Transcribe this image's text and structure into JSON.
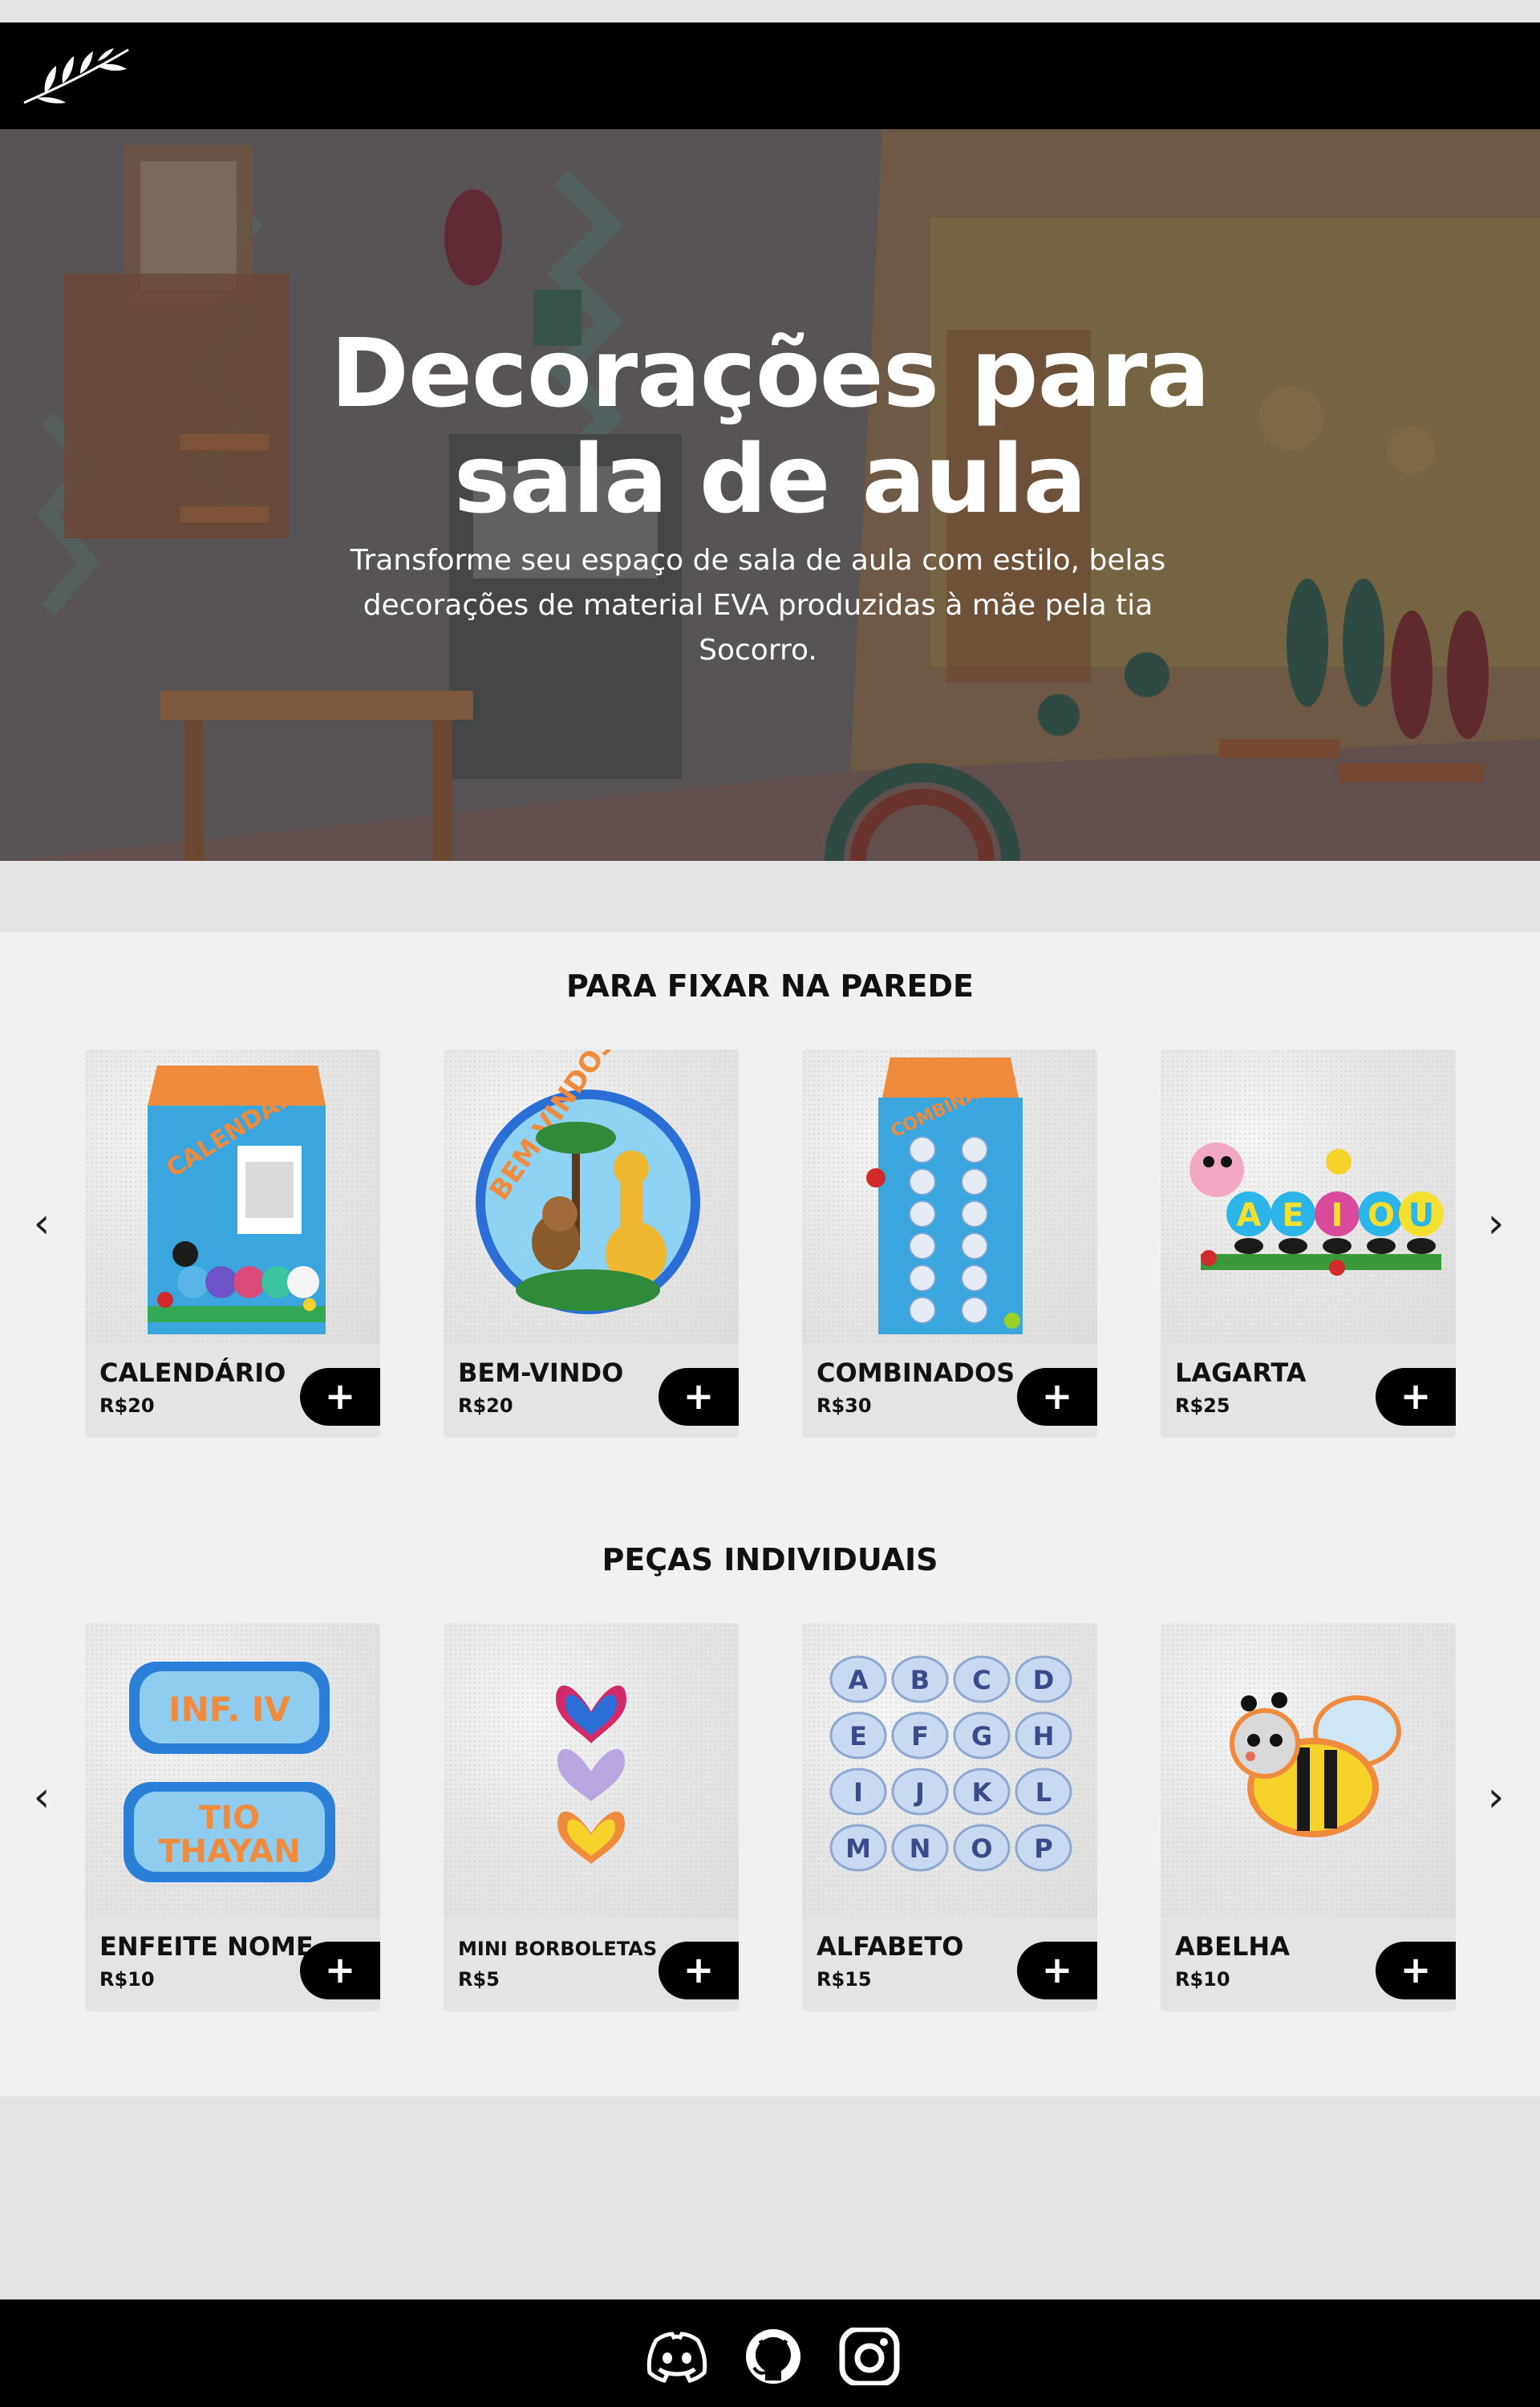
{
  "header": {
    "logo_icon": "leaf-branch-logo-icon"
  },
  "hero": {
    "title_line1": "Decorações para",
    "title_line2": "sala de aula",
    "subtitle": "Transforme seu espaço de sala de aula com estilo, belas decorações de material EVA produzidas à mãe pela tia Socorro."
  },
  "carousel_arrows": {
    "prev": "‹",
    "next": "›"
  },
  "section_wall": {
    "title": "PARA FIXAR NA PAREDE",
    "items": [
      {
        "name": "CALENDÁRIO",
        "price": "R$20",
        "add_label": "+",
        "image_icon": "calendar-decoration-image"
      },
      {
        "name": "BEM-VINDO",
        "price": "R$20",
        "add_label": "+",
        "image_icon": "welcome-sign-image"
      },
      {
        "name": "COMBINADOS",
        "price": "R$30",
        "add_label": "+",
        "image_icon": "rules-board-image"
      },
      {
        "name": "LAGARTA",
        "price": "R$25",
        "add_label": "+",
        "image_icon": "caterpillar-vowels-image"
      }
    ],
    "image_text": {
      "calendar": "CALENDÁRIO",
      "welcome": "BEM-VINDOS",
      "rules": "COMBINADOS",
      "vowels": [
        "A",
        "E",
        "I",
        "O",
        "U"
      ]
    }
  },
  "section_pieces": {
    "title": "PEÇAS INDIVIDUAIS",
    "items": [
      {
        "name": "ENFEITE NOME",
        "price": "R$10",
        "add_label": "+",
        "image_icon": "name-plates-image"
      },
      {
        "name": "MINI BORBOLETAS",
        "price": "R$5",
        "add_label": "+",
        "image_icon": "mini-butterflies-image"
      },
      {
        "name": "ALFABETO",
        "price": "R$15",
        "add_label": "+",
        "image_icon": "alphabet-clouds-image"
      },
      {
        "name": "ABELHA",
        "price": "R$10",
        "add_label": "+",
        "image_icon": "bee-image"
      }
    ],
    "image_text": {
      "plate1": "INF. IV",
      "plate2_line1": "TIO",
      "plate2_line2": "THAYAN",
      "letters": [
        "A",
        "B",
        "C",
        "D",
        "E",
        "F",
        "G",
        "H",
        "I",
        "J",
        "K",
        "L",
        "M",
        "N",
        "O",
        "P"
      ]
    }
  },
  "footer": {
    "icons": [
      "discord-icon",
      "github-icon",
      "instagram-icon"
    ]
  }
}
